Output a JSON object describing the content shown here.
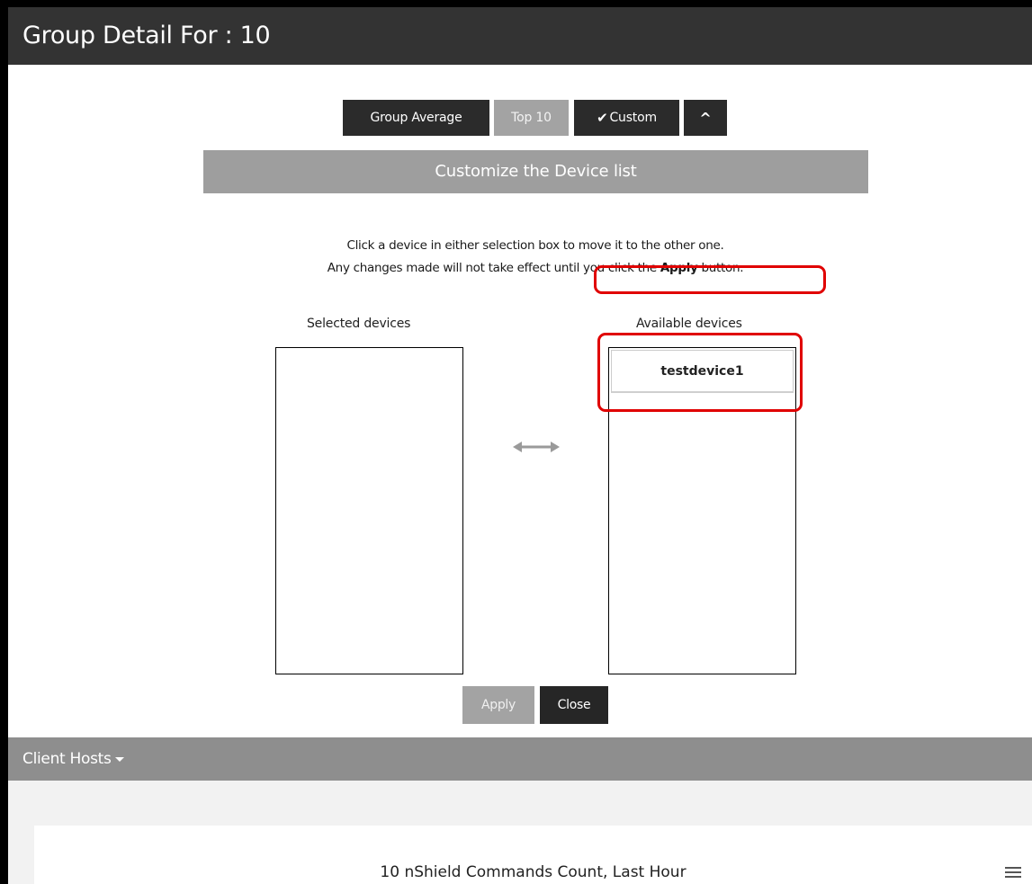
{
  "header": {
    "title": "Group Detail For : 10"
  },
  "toolbar": {
    "group_average": "Group Average",
    "top10": "Top 10",
    "custom": "Custom",
    "check_glyph": "✔",
    "collapse_glyph": "^"
  },
  "customize": {
    "title": "Customize the Device list",
    "instruction_line1": "Click a device in either selection box to move it to the other one.",
    "instruction_line2_pre": "Any changes made will not take effect until you click the ",
    "instruction_line2_bold": "Apply",
    "instruction_line2_post": " button.",
    "selected_label": "Selected devices",
    "available_label": "Available devices",
    "selected_devices": [],
    "available_devices": [
      "testdevice1"
    ],
    "apply": "Apply",
    "close": "Close"
  },
  "client_hosts": {
    "label": "Client Hosts"
  },
  "chart": {
    "title": "10 nShield Commands Count, Last Hour"
  },
  "colors": {
    "highlight": "#e00000",
    "header_bg": "#333333",
    "band_bg": "#9e9e9e"
  }
}
